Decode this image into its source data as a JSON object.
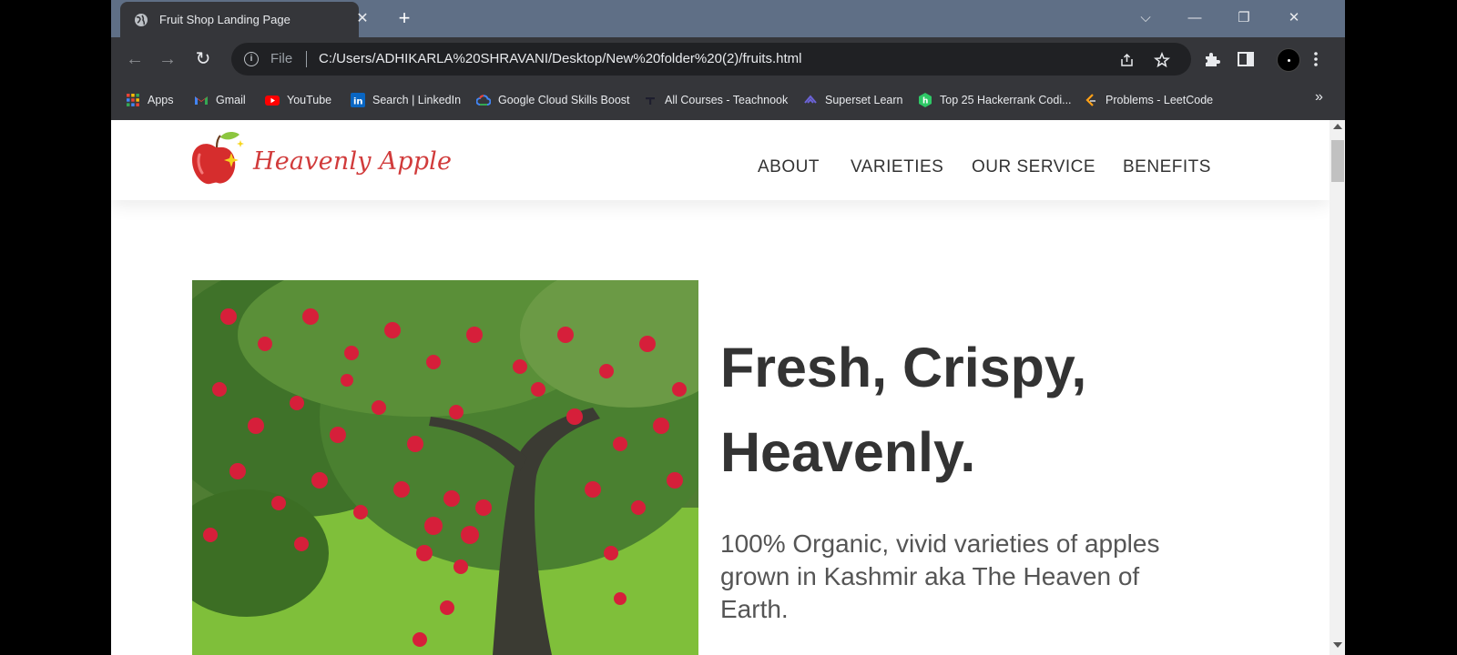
{
  "browser": {
    "tab": {
      "title": "Fruit Shop Landing Page",
      "close_glyph": "✕"
    },
    "new_tab_glyph": "+",
    "window_controls": {
      "tab_search_glyph": "⌵",
      "minimize_glyph": "—",
      "restore_glyph": "❐",
      "close_glyph": "✕"
    },
    "toolbar": {
      "back_glyph": "←",
      "forward_glyph": "→",
      "reload_glyph": "↻",
      "info_glyph": "i",
      "file_label": "File",
      "url": "C:/Users/ADHIKARLA%20SHRAVANI/Desktop/New%20folder%20(2)/fruits.html"
    },
    "bookmarks": [
      {
        "label": "Apps",
        "icon": "apps-grid-icon"
      },
      {
        "label": "Gmail",
        "icon": "gmail-icon"
      },
      {
        "label": "YouTube",
        "icon": "youtube-icon"
      },
      {
        "label": "Search | LinkedIn",
        "icon": "linkedin-icon"
      },
      {
        "label": "Google Cloud Skills Boost",
        "icon": "google-cloud-icon"
      },
      {
        "label": "All Courses - Teachnook",
        "icon": "teachnook-icon"
      },
      {
        "label": "Superset Learn",
        "icon": "superset-icon"
      },
      {
        "label": "Top 25 Hackerrank Codi...",
        "icon": "hackerrank-icon"
      },
      {
        "label": "Problems - LeetCode",
        "icon": "leetcode-icon"
      }
    ],
    "bookmarks_more_glyph": "»",
    "colors": {
      "tabstrip": "#5f6f86",
      "toolbar": "#35363a",
      "omnibox": "#202124"
    }
  },
  "site": {
    "logo_text": "Heavenly Apple",
    "nav": [
      "ABOUT",
      "VARIETIES",
      "OUR SERVICE",
      "BENEFITS"
    ],
    "hero": {
      "headline_line1": "Fresh, Crispy,",
      "headline_line2": "Heavenly.",
      "subtext": "100% Organic, vivid varieties of apples grown in Kashmir aka The Heaven of Earth."
    },
    "colors": {
      "logo_red": "#d13b3b",
      "heading": "#333333",
      "body_text": "#555555"
    }
  }
}
